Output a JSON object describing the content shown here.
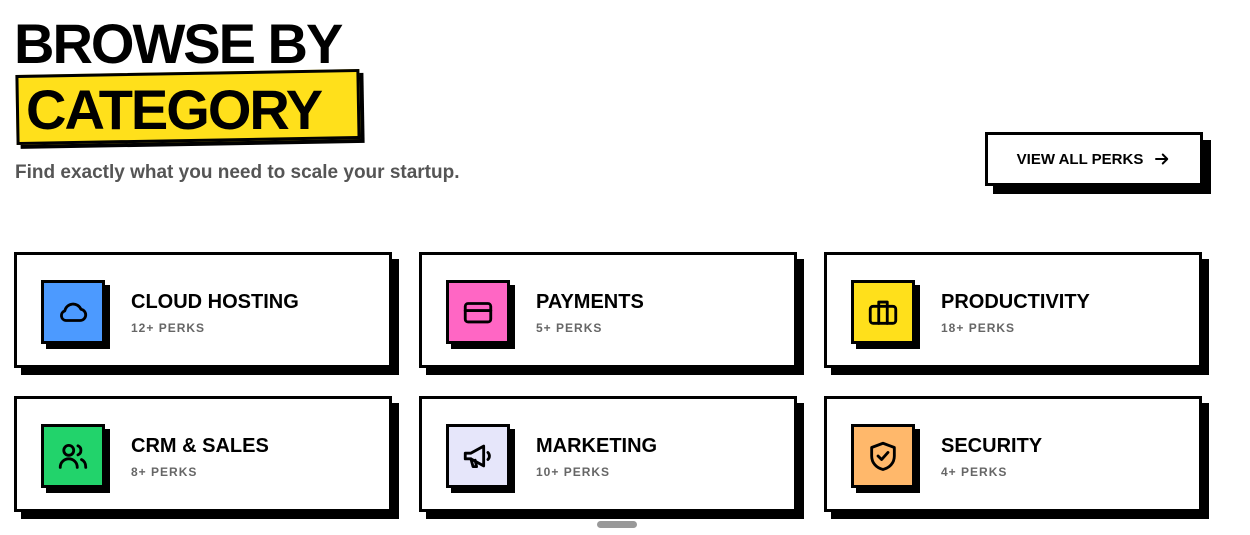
{
  "header": {
    "title_line1": "BROWSE BY",
    "title_line2": "CATEGORY",
    "subtitle": "Find exactly what you need to scale your startup.",
    "highlight_color": "#ffe01b"
  },
  "view_all_button": {
    "label": "VIEW ALL PERKS",
    "icon": "arrow-right-icon"
  },
  "categories": [
    {
      "title": "CLOUD HOSTING",
      "count": "12+ PERKS",
      "icon": "cloud-icon",
      "color": "#4c9aff"
    },
    {
      "title": "PAYMENTS",
      "count": "5+ PERKS",
      "icon": "credit-card-icon",
      "color": "#ff66c4"
    },
    {
      "title": "PRODUCTIVITY",
      "count": "18+ PERKS",
      "icon": "briefcase-icon",
      "color": "#ffe01b"
    },
    {
      "title": "CRM & SALES",
      "count": "8+ PERKS",
      "icon": "users-icon",
      "color": "#22d36b"
    },
    {
      "title": "MARKETING",
      "count": "10+ PERKS",
      "icon": "megaphone-icon",
      "color": "#e6e6fa"
    },
    {
      "title": "SECURITY",
      "count": "4+ PERKS",
      "icon": "shield-check-icon",
      "color": "#ffb86b"
    }
  ]
}
